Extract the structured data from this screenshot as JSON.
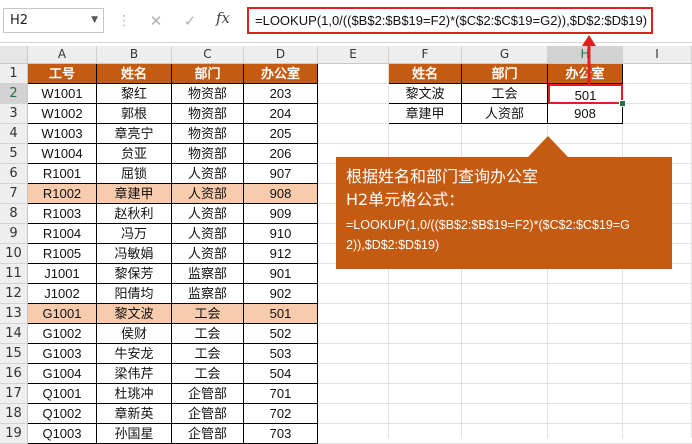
{
  "namebox": {
    "value": "H2"
  },
  "formula_bar": {
    "cancel_symbol": "✕",
    "confirm_symbol": "✓",
    "fx_label": "fx",
    "formula": "=LOOKUP(1,0/(($B$2:$B$19=F2)*($C$2:$C$19=G2)),$D$2:$D$19)"
  },
  "columns": [
    "A",
    "B",
    "C",
    "D",
    "E",
    "F",
    "G",
    "H",
    "I"
  ],
  "rows": [
    "1",
    "2",
    "3",
    "4",
    "5",
    "6",
    "7",
    "8",
    "9",
    "10",
    "11",
    "12",
    "13",
    "14",
    "15",
    "16",
    "17",
    "18",
    "19"
  ],
  "main_table": {
    "headers": [
      "工号",
      "姓名",
      "部门",
      "办公室"
    ],
    "rows": [
      [
        "W1001",
        "黎红",
        "物资部",
        "203"
      ],
      [
        "W1002",
        "郭根",
        "物资部",
        "204"
      ],
      [
        "W1003",
        "章亮宁",
        "物资部",
        "205"
      ],
      [
        "W1004",
        "贠亚",
        "物资部",
        "206"
      ],
      [
        "R1001",
        "屈锁",
        "人资部",
        "907"
      ],
      [
        "R1002",
        "章建甲",
        "人资部",
        "908"
      ],
      [
        "R1003",
        "赵秋利",
        "人资部",
        "909"
      ],
      [
        "R1004",
        "冯万",
        "人资部",
        "910"
      ],
      [
        "R1005",
        "冯敏娟",
        "人资部",
        "912"
      ],
      [
        "J1001",
        "黎保芳",
        "监察部",
        "901"
      ],
      [
        "J1002",
        "阳倩均",
        "监察部",
        "902"
      ],
      [
        "G1001",
        "黎文波",
        "工会",
        "501"
      ],
      [
        "G1002",
        "侯财",
        "工会",
        "502"
      ],
      [
        "G1003",
        "牛安龙",
        "工会",
        "503"
      ],
      [
        "G1004",
        "梁伟芹",
        "工会",
        "504"
      ],
      [
        "Q1001",
        "杜珧冲",
        "企管部",
        "701"
      ],
      [
        "Q1002",
        "章新英",
        "企管部",
        "702"
      ],
      [
        "Q1003",
        "孙国星",
        "企管部",
        "703"
      ]
    ],
    "highlighted_rows": [
      5,
      11
    ]
  },
  "lookup_table": {
    "headers": [
      "姓名",
      "部门",
      "办公室"
    ],
    "rows": [
      [
        "黎文波",
        "工会",
        "501"
      ],
      [
        "章建甲",
        "人资部",
        "908"
      ]
    ]
  },
  "callout": {
    "line1": "根据姓名和部门查询办公室",
    "line2": "H2单元格公式：",
    "formula": "=LOOKUP(1,0/(($B$2:$B$19=F2)*($C$2:$C$19=G2)),$D$2:$D$19)"
  },
  "colors": {
    "header_fill": "#c55a11",
    "highlight_fill": "#f8cbad",
    "accent_red": "#e02020"
  }
}
